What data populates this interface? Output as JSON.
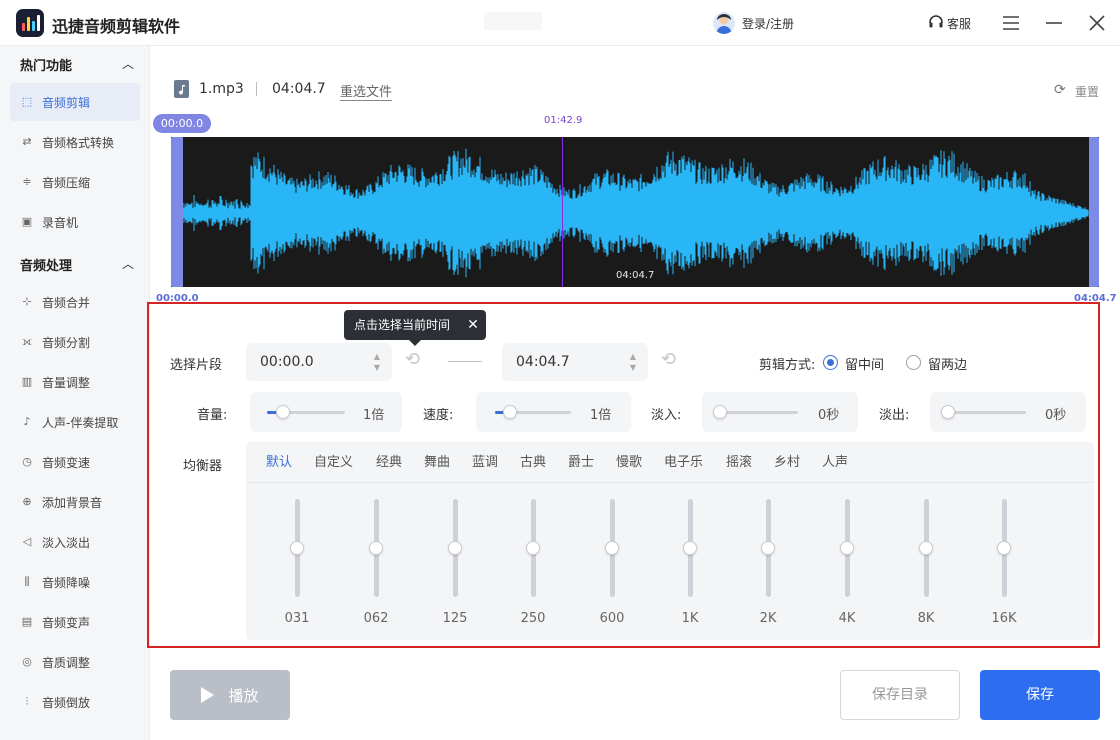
{
  "app": {
    "title": "迅捷音频剪辑软件",
    "login": "登录/注册",
    "service": "客服"
  },
  "sidebar": {
    "section_hot": "热门功能",
    "hot_items": [
      {
        "label": "音频剪辑",
        "icon": "trim-icon",
        "active": true
      },
      {
        "label": "音频格式转换",
        "icon": "convert-icon"
      },
      {
        "label": "音频压缩",
        "icon": "compress-icon"
      },
      {
        "label": "录音机",
        "icon": "recorder-icon"
      }
    ],
    "section_process": "音频处理",
    "process_items": [
      {
        "label": "音频合并",
        "icon": "merge-icon"
      },
      {
        "label": "音频分割",
        "icon": "split-icon"
      },
      {
        "label": "音量调整",
        "icon": "volume-icon"
      },
      {
        "label": "人声-伴奏提取",
        "icon": "vocal-icon"
      },
      {
        "label": "音频变速",
        "icon": "speed-icon"
      },
      {
        "label": "添加背景音",
        "icon": "add-bg-icon"
      },
      {
        "label": "淡入淡出",
        "icon": "fade-icon"
      },
      {
        "label": "音频降噪",
        "icon": "denoise-icon"
      },
      {
        "label": "音频变声",
        "icon": "voice-change-icon"
      },
      {
        "label": "音质调整",
        "icon": "quality-icon"
      },
      {
        "label": "音频倒放",
        "icon": "reverse-icon"
      }
    ]
  },
  "file": {
    "name": "1.mp3",
    "duration": "04:04.7",
    "reselect": "重选文件",
    "reset": "重置"
  },
  "waveform": {
    "start_badge": "00:00.0",
    "playhead_time": "01:42.9",
    "playhead_fraction": 0.42,
    "inner_time": "04:04.7",
    "axis_start": "00:00.0",
    "axis_end": "04:04.7",
    "wave_color": "#29b6f6"
  },
  "tooltip": {
    "text": "点击选择当前时间",
    "close": "✕"
  },
  "segment": {
    "label": "选择片段",
    "start": "00:00.0",
    "end": "04:04.7"
  },
  "edit_mode": {
    "label": "剪辑方式:",
    "options": [
      "留中间",
      "留两边"
    ],
    "selected": 0
  },
  "volume": {
    "label": "音量:",
    "value": "1倍",
    "level": 0.2
  },
  "speed": {
    "label": "速度:",
    "value": "1倍",
    "level": 0.2
  },
  "fade_in": {
    "label": "淡入:",
    "value": "0秒",
    "level": 0.0
  },
  "fade_out": {
    "label": "淡出:",
    "value": "0秒",
    "level": 0.0
  },
  "equalizer": {
    "label": "均衡器",
    "presets": [
      "默认",
      "自定义",
      "经典",
      "舞曲",
      "蓝调",
      "古典",
      "爵士",
      "慢歌",
      "电子乐",
      "摇滚",
      "乡村",
      "人声"
    ],
    "selected_preset": 0,
    "bands": [
      "031",
      "062",
      "125",
      "250",
      "600",
      "1K",
      "2K",
      "4K",
      "8K",
      "16K"
    ]
  },
  "footer": {
    "play": "播放",
    "save_dir": "保存目录",
    "save": "保存"
  },
  "colors": {
    "accent": "#3a6fd8",
    "frame": "#d42424",
    "save": "#2d6ef0"
  }
}
